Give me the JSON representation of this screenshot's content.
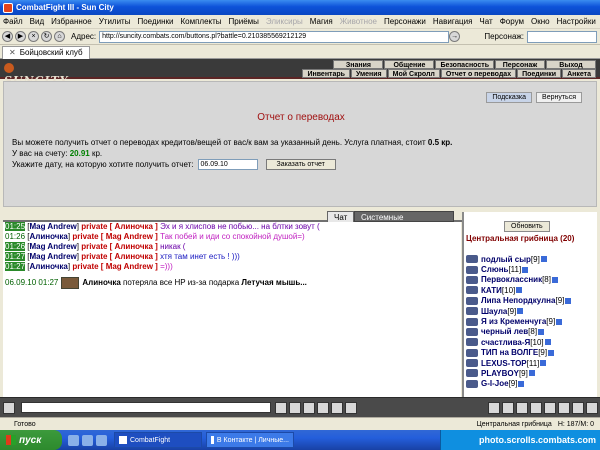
{
  "window": {
    "title": "CombatFight III - Sun City"
  },
  "menu": [
    "Файл",
    "Вид",
    "Избранное",
    "Утилиты",
    "Поединки",
    "Комплекты",
    "Приёмы",
    "Эликсиры",
    "Магия",
    "Животное",
    "Персонажи",
    "Навигация",
    "Чат",
    "Форум",
    "Окно",
    "Настройки",
    "?"
  ],
  "address": {
    "label": "Адрес:",
    "url": "http://suncity.combats.com/buttons.pl?battle=0.210385569212129",
    "pers_label": "Персонаж:"
  },
  "tab": {
    "label": "Бойцовский клуб"
  },
  "game": {
    "logo": "SUNCITY",
    "nav_top": [
      "Знания",
      "Общение",
      "Безопасность",
      "Персонаж",
      "Выход"
    ],
    "nav_bottom": [
      "Инвентарь",
      "Умения",
      "Мой Скролл",
      "Отчет о переводах",
      "Поединки",
      "Анкета"
    ]
  },
  "report": {
    "hint": "Подсказка",
    "back": "Вернуться",
    "title": "Отчет о переводах",
    "desc": "Вы можете получить отчет о переводах кредитов/вещей от вас/к вам за указанный день. Услуга платная, стоит",
    "price": "0.5 кр.",
    "balance_label": "У вас на счету:",
    "balance": "20.91",
    "balance_unit": "кр.",
    "date_label": "Укажите дату, на которую хотите получить отчет:",
    "date_value": "06.09.10",
    "order_btn": "Заказать отчет"
  },
  "chat": {
    "tab_chat": "Чат",
    "tab_sys": "Системные сообщения",
    "lines": [
      {
        "time": "01:25",
        "from": "Mag Andrew",
        "private": "private [ Алиночка ]",
        "msg": "Эх и я хлиспов не побью... на блтки зовут (",
        "hl": true,
        "style": "m"
      },
      {
        "time": "01:26",
        "from": "Алиночка",
        "private": "private [ Mag Andrew ]",
        "msg": "Так побей и иди со спокойной душой=)",
        "hl": false,
        "style": "m3"
      },
      {
        "time": "01:26",
        "from": "Mag Andrew",
        "private": "private [ Алиночка ]",
        "msg": "никак (",
        "hl": true,
        "style": "m"
      },
      {
        "time": "01:27",
        "from": "Mag Andrew",
        "private": "private [ Алиночка ]",
        "msg": "хтя там инет есть ! )))",
        "hl": true,
        "style": "m2"
      },
      {
        "time": "01:27",
        "from": "Алиночка",
        "private": "private [ Mag Andrew ]",
        "msg": "=)))",
        "hl": true,
        "style": "m3"
      }
    ],
    "system": {
      "time": "06.09.10 01:27",
      "name": "Алиночка",
      "text": "потеряла все HP из-за подарка",
      "gift": "Летучая мышь..."
    }
  },
  "room": {
    "refresh": "Обновить",
    "title": "Центральная грибница (20)",
    "users": [
      {
        "name": "подлый сыр",
        "level": "[9]"
      },
      {
        "name": "Слюнь",
        "level": "[11]"
      },
      {
        "name": "Первоклассник",
        "level": "[8]"
      },
      {
        "name": "КАТИ",
        "level": "[10]"
      },
      {
        "name": "Липа Непордкулна",
        "level": "[9]"
      },
      {
        "name": "Шаула",
        "level": "[9]"
      },
      {
        "name": "Я из Кременчуга",
        "level": "[9]"
      },
      {
        "name": "черный лев",
        "level": "[8]"
      },
      {
        "name": "счастлива-Я",
        "level": "[10]"
      },
      {
        "name": "ТИП на ВОЛГЕ",
        "level": "[9]"
      },
      {
        "name": "LEXUS-TOP",
        "level": "[11]"
      },
      {
        "name": "PLAYBOY",
        "level": "[9]"
      },
      {
        "name": "G-I-Joe",
        "level": "[9]"
      }
    ]
  },
  "statusbar": {
    "ready": "Готово",
    "zone": "Центральная грибница",
    "hm": "H: 187/M: 0"
  },
  "taskbar": {
    "start": "пуск",
    "tasks": [
      "CombatFight",
      "В Контакте | Личные..."
    ],
    "watermark": "photo.scrolls.combats.com"
  },
  "colors": {
    "title_blue": "#0d52d9",
    "report_title": "#a01010",
    "nick": "#00006a",
    "private": "#c00000",
    "room_title": "#800000"
  }
}
